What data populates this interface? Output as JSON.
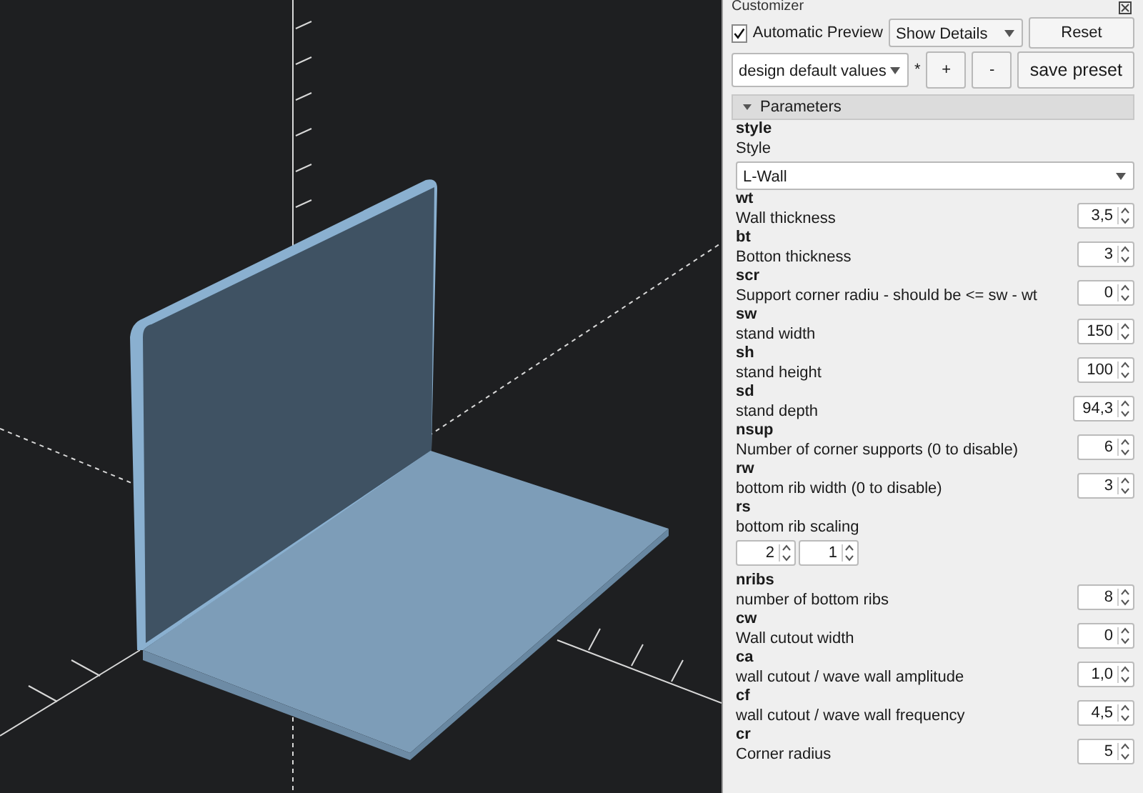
{
  "panel": {
    "title": "Customizer",
    "automatic_preview": {
      "label": "Automatic Preview",
      "checked": true
    },
    "details_dropdown": "Show Details",
    "reset_button": "Reset",
    "preset_dropdown": "design default values",
    "modified_marker": "*",
    "add_button": "+",
    "remove_button": "-",
    "save_button": "save preset",
    "section": {
      "title": "Parameters",
      "expanded": true
    },
    "parameters": [
      {
        "kind": "dropdown",
        "name": "style",
        "description": "Style",
        "value": "L-Wall"
      },
      {
        "kind": "spin",
        "name": "wt",
        "description": "Wall thickness",
        "value": "3,5"
      },
      {
        "kind": "spin",
        "name": "bt",
        "description": "Botton thickness",
        "value": "3"
      },
      {
        "kind": "spin",
        "name": "scr",
        "description": "Support corner radiu - should be <= sw - wt",
        "value": "0"
      },
      {
        "kind": "spin",
        "name": "sw",
        "description": "stand width",
        "value": "150"
      },
      {
        "kind": "spin",
        "name": "sh",
        "description": "stand height",
        "value": "100"
      },
      {
        "kind": "spin",
        "name": "sd",
        "description": "stand depth",
        "value": "94,3"
      },
      {
        "kind": "spin",
        "name": "nsup",
        "description": "Number of corner supports (0 to disable)",
        "value": "6"
      },
      {
        "kind": "spin",
        "name": "rw",
        "description": "bottom rib width (0 to disable)",
        "value": "3"
      },
      {
        "kind": "vector",
        "name": "rs",
        "description": "bottom rib scaling",
        "values": [
          "2",
          "1"
        ]
      },
      {
        "kind": "spin",
        "name": "nribs",
        "description": "number of bottom ribs",
        "value": "8"
      },
      {
        "kind": "spin",
        "name": "cw",
        "description": "Wall cutout width",
        "value": "0"
      },
      {
        "kind": "spin",
        "name": "ca",
        "description": "wall cutout / wave wall amplitude",
        "value": "1,0"
      },
      {
        "kind": "spin",
        "name": "cf",
        "description": "wall cutout / wave wall frequency",
        "value": "4,5"
      },
      {
        "kind": "spin",
        "name": "cr",
        "description": "Corner radius",
        "value": "5"
      }
    ]
  }
}
